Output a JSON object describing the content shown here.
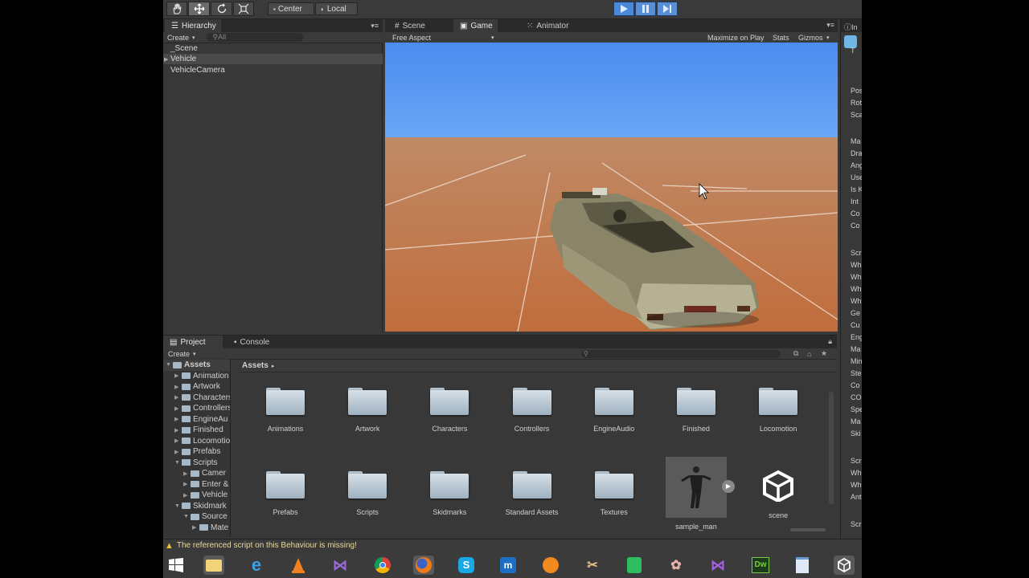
{
  "toolbar": {
    "tools": [
      "hand-icon",
      "move-icon",
      "rotate-icon",
      "scale-icon"
    ],
    "pivot_center": "Center",
    "pivot_local": "Local"
  },
  "hierarchy": {
    "tab": "Hierarchy",
    "create": "Create",
    "search_placeholder": "All",
    "items": [
      "_Scene",
      "Vehicle",
      "VehicleCamera"
    ]
  },
  "view_tabs": {
    "scene": "Scene",
    "game": "Game",
    "animator": "Animator"
  },
  "game_bar": {
    "aspect": "Free Aspect",
    "maximize": "Maximize on Play",
    "stats": "Stats",
    "gizmos": "Gizmos"
  },
  "project": {
    "tab": "Project",
    "console_tab": "Console",
    "create": "Create",
    "breadcrumb": "Assets",
    "tree": [
      {
        "label": "Assets",
        "indent": 0,
        "open": true
      },
      {
        "label": "Animation",
        "indent": 1
      },
      {
        "label": "Artwork",
        "indent": 1
      },
      {
        "label": "Characters",
        "indent": 1
      },
      {
        "label": "Controllers",
        "indent": 1
      },
      {
        "label": "EngineAu",
        "indent": 1
      },
      {
        "label": "Finished",
        "indent": 1
      },
      {
        "label": "Locomotio",
        "indent": 1
      },
      {
        "label": "Prefabs",
        "indent": 1
      },
      {
        "label": "Scripts",
        "indent": 1,
        "open": true
      },
      {
        "label": "Camer",
        "indent": 2
      },
      {
        "label": "Enter &",
        "indent": 2
      },
      {
        "label": "Vehicle",
        "indent": 2
      },
      {
        "label": "Skidmark",
        "indent": 1,
        "open": true
      },
      {
        "label": "Source",
        "indent": 2,
        "open": true
      },
      {
        "label": "Mate",
        "indent": 3
      }
    ],
    "assets_row1": [
      "Animations",
      "Artwork",
      "Characters",
      "Controllers",
      "EngineAudio",
      "Finished",
      "Locomotion"
    ],
    "assets_row2": [
      "Prefabs",
      "Scripts",
      "Skidmarks",
      "Standard Assets",
      "Textures",
      "sample_man",
      "scene"
    ]
  },
  "inspector": {
    "tab": "In",
    "rows": [
      "T",
      "Pos",
      "Rot",
      "Sca",
      "Ma",
      "Dra",
      "Ang",
      "Use",
      "Is K",
      "Int",
      "Co",
      "Co",
      "Scr",
      "Wh",
      "Wh",
      "Wh",
      "Wh",
      "Ge",
      "Cu",
      "Eng",
      "Ma",
      "Min",
      "Ste",
      "Co",
      "CO",
      "Spe",
      "Ma",
      "Ski",
      "Scr",
      "Wh",
      "Wh",
      "Ant",
      "Scr"
    ]
  },
  "status": {
    "message": "The referenced script on this Behaviour is missing!"
  },
  "taskbar": {
    "icons": [
      "windows-start-icon",
      "file-explorer-icon",
      "internet-explorer-icon",
      "vlc-icon",
      "visual-studio-icon",
      "chrome-icon",
      "firefox-icon",
      "skype-icon",
      "maxthon-icon",
      "orange-app-icon",
      "tool-app-icon",
      "evernote-icon",
      "paint-app-icon",
      "visual-studio-2-icon",
      "dreamweaver-icon",
      "notepad-icon",
      "unity-icon"
    ],
    "dw_label": "Dw"
  },
  "colors": {
    "sky": "#4f8ff0",
    "ground": "#c87a4c",
    "play_active": "#4a89d9",
    "editor_bg": "#383838"
  }
}
